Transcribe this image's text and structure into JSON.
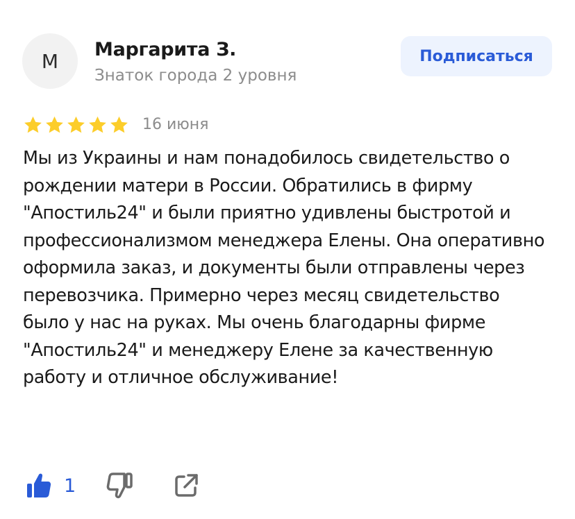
{
  "author": {
    "avatar_letter": "М",
    "name": "Маргарита З.",
    "level": "Знаток города 2 уровня"
  },
  "subscribe_label": "Подписаться",
  "rating": {
    "stars": 5,
    "max": 5,
    "color": "#fccd2a"
  },
  "date": "16 июня",
  "review_text": "Мы из Украины и нам понадобилось свидетельство о рождении матери в России. Обратились в фирму \"Апостиль24\" и были приятно удивлены быстротой и профессионализмом менеджера Елены. Она оперативно оформила заказ, и документы были отправлены через перевозчика. Примерно через месяц свидетельство было у нас на руках. Мы очень благодарны фирме \"Апостиль24\" и менеджеру Елене за качественную работу и отличное обслуживание!",
  "actions": {
    "like_count": "1",
    "like_icon": "thumbs-up-filled",
    "dislike_icon": "thumbs-down-outline",
    "share_icon": "share-external"
  },
  "colors": {
    "accent": "#2a5bd7",
    "button_bg": "#edf3fe",
    "secondary_text": "#8c8c8c",
    "icon_gray": "#6b6b6b"
  }
}
